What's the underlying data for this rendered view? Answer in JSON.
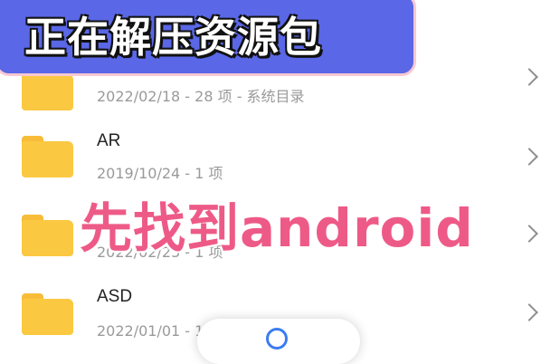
{
  "banner": {
    "text": "正在解压资源包"
  },
  "overlay": {
    "text": "先找到android"
  },
  "files": [
    {
      "name": "",
      "meta": "2022/02/18 - 28 项 - 系统目录"
    },
    {
      "name": "AR",
      "meta": "2019/10/24 - 1 项"
    },
    {
      "name": "",
      "meta": "2022/02/23 - 1 项"
    },
    {
      "name": "ASD",
      "meta": "2022/01/01 - 1 项"
    }
  ],
  "colors": {
    "folder": "#fbc842",
    "banner": "#5a67e6",
    "overlay_text": "#ee5a87",
    "accent": "#3b7cf0"
  },
  "icons": {
    "folder": "folder-icon",
    "chevron": "chevron-right-icon",
    "search": "search-icon"
  }
}
